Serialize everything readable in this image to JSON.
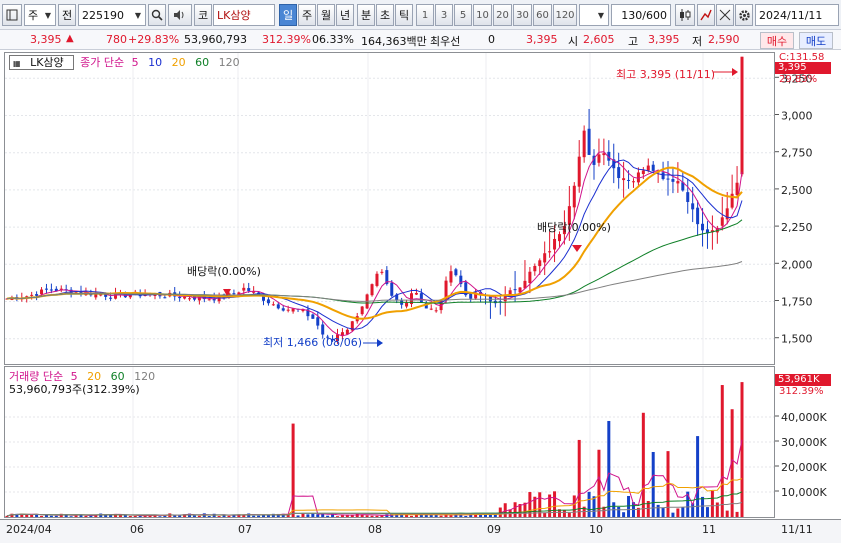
{
  "toolbar": {
    "market_label": "주",
    "period_label": "전",
    "code": "225190",
    "code_type": "코",
    "stock_name": "LK삼양",
    "periods": [
      "일",
      "주",
      "월",
      "년",
      "분",
      "초",
      "틱"
    ],
    "active_period": "일",
    "intervals": [
      "1",
      "3",
      "5",
      "10",
      "20",
      "30",
      "60",
      "120"
    ],
    "count": "130/600",
    "date": "2024/11/11"
  },
  "info": {
    "price": "3,395",
    "change": "780",
    "change_pct": "+29.83%",
    "volume": "53,960,793",
    "volume_pct": "312.39%",
    "turnover": "06.33%",
    "amount": "164,363백만",
    "pref_label": "최우선",
    "pref_value": "0",
    "pref_price": "3,395",
    "open_label": "시",
    "open": "2,605",
    "high_label": "고",
    "high": "3,395",
    "low_label": "저",
    "low": "2,590",
    "buy_label": "매수",
    "sell_label": "매도"
  },
  "price_pane": {
    "name_box": "LK삼양",
    "ma_title": "종가 단순",
    "ma_periods": [
      "5",
      "10",
      "20",
      "60",
      "120"
    ],
    "ma_colors": [
      "#d0148c",
      "#1b2fd0",
      "#f0a000",
      "#108028",
      "#808080"
    ],
    "high_annotation": "최고 3,395 (11/11)",
    "low_annotation": "최저 1,466 (08/06)",
    "dividend_label_1": "배당락(0.00%)",
    "dividend_label_2": "배당락(0.00%)",
    "right_top_label": "C:131.58",
    "price_tag": "3,395",
    "price_tag_pct": "29.83%"
  },
  "volume_pane": {
    "title": "거래량 단순",
    "ma_periods": [
      "5",
      "20",
      "60",
      "120"
    ],
    "ma_colors": [
      "#d0148c",
      "#f0a000",
      "#108028",
      "#808080"
    ],
    "value_line": "53,960,793주(312.39%)",
    "vol_tag": "53,961K",
    "vol_tag_pct": "312.39%"
  },
  "price_axis": {
    "ticks": [
      "3,250",
      "3,000",
      "2,750",
      "2,500",
      "2,250",
      "2,000",
      "1,750",
      "1,500"
    ],
    "tick_values": [
      3250,
      3000,
      2750,
      2500,
      2250,
      2000,
      1750,
      1500
    ]
  },
  "volume_axis": {
    "ticks": [
      "40,000K",
      "30,000K",
      "20,000K",
      "10,000K"
    ],
    "tick_values": [
      40000,
      30000,
      20000,
      10000
    ]
  },
  "x_axis": {
    "labels": [
      "2024/04",
      "06",
      "07",
      "08",
      "09",
      "10",
      "11",
      "11/11"
    ]
  },
  "colors": {
    "up": "#e0182d",
    "down": "#1440c8",
    "vol_up": "#e0182d",
    "vol_down": "#1440c8"
  },
  "chart_data": {
    "type": "candlestick",
    "title": "",
    "ylim": [
      1330,
      3420
    ],
    "volume_ylim": [
      0,
      60000
    ],
    "period_range": [
      "2024/04",
      "11/11"
    ],
    "candles_approx": [
      {
        "date": "08/06",
        "low": 1466
      },
      {
        "date": "11/11",
        "open": 2605,
        "high": 3395,
        "low": 2590,
        "close": 3395,
        "volume": 53961
      }
    ]
  }
}
